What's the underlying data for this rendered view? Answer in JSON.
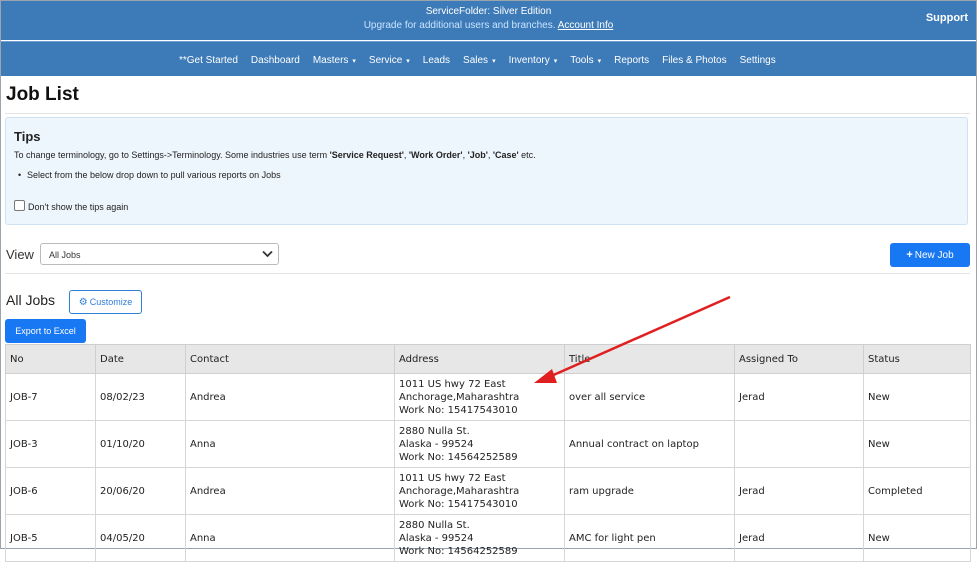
{
  "topbar": {
    "edition": "ServiceFolder: Silver Edition",
    "upgrade_text": "Upgrade for additional users and branches.",
    "account_link": "Account Info",
    "support": "Support"
  },
  "nav": [
    {
      "label": "**Get Started",
      "caret": false
    },
    {
      "label": "Dashboard",
      "caret": false
    },
    {
      "label": "Masters",
      "caret": true
    },
    {
      "label": "Service",
      "caret": true
    },
    {
      "label": "Leads",
      "caret": false
    },
    {
      "label": "Sales",
      "caret": true
    },
    {
      "label": "Inventory",
      "caret": true
    },
    {
      "label": "Tools",
      "caret": true
    },
    {
      "label": "Reports",
      "caret": false
    },
    {
      "label": "Files & Photos",
      "caret": false
    },
    {
      "label": "Settings",
      "caret": false
    }
  ],
  "page": {
    "title": "Job List"
  },
  "tips": {
    "title": "Tips",
    "line1_prefix": "To change terminology, go to Settings->Terminology. Some industries use term ",
    "terms": [
      "'Service Request'",
      "'Work Order'",
      "'Job'",
      "'Case'"
    ],
    "line1_suffix": " etc.",
    "bullet": "Select from the below drop down to pull various reports on Jobs",
    "checkbox_label": "Don't show the tips again"
  },
  "view": {
    "label": "View",
    "selected": "All Jobs"
  },
  "buttons": {
    "new_job": "New Job",
    "customize": "Customize",
    "export": "Export to Excel"
  },
  "list": {
    "heading": "All Jobs",
    "columns": [
      "No",
      "Date",
      "Contact",
      "Address",
      "Title",
      "Assigned To",
      "Status"
    ],
    "rows": [
      {
        "no": "JOB-7",
        "date": "08/02/23",
        "contact": "Andrea",
        "address": [
          "1011 US hwy 72 East",
          "Anchorage,Maharashtra",
          "Work No: 15417543010"
        ],
        "title": "over all service",
        "assigned": "Jerad",
        "status": "New"
      },
      {
        "no": "JOB-3",
        "date": "01/10/20",
        "contact": "Anna",
        "address": [
          "2880 Nulla St.",
          "Alaska - 99524",
          "Work No: 14564252589"
        ],
        "title": "Annual contract on laptop",
        "assigned": "",
        "status": "New"
      },
      {
        "no": "JOB-6",
        "date": "20/06/20",
        "contact": "Andrea",
        "address": [
          "1011 US hwy 72 East",
          "Anchorage,Maharashtra",
          "Work No: 15417543010"
        ],
        "title": "ram upgrade",
        "assigned": "Jerad",
        "status": "Completed"
      },
      {
        "no": "JOB-5",
        "date": "04/05/20",
        "contact": "Anna",
        "address": [
          "2880 Nulla St.",
          "Alaska - 99524",
          "Work No: 14564252589"
        ],
        "title": "AMC for light pen",
        "assigned": "Jerad",
        "status": "New"
      }
    ]
  },
  "colors": {
    "header_bg": "#3d7ab8",
    "primary_button": "#1877f2",
    "annotation_arrow": "#e02020"
  }
}
